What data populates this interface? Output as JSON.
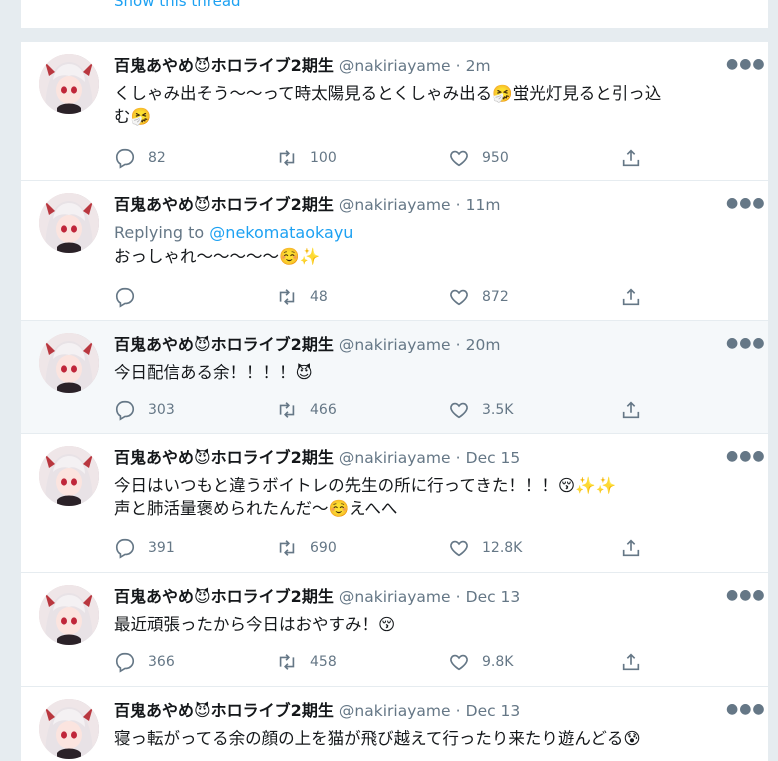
{
  "thread": {
    "show_thread_label": "Show this thread"
  },
  "tweets": [
    {
      "name": "百鬼あやめ😈ホロライブ2期生",
      "handle": "@nakiriayame",
      "dot": "·",
      "time": "2m",
      "reply_prefix": "",
      "reply_to": "",
      "lines": [
        "くしゃみ出そう〜〜って時太陽見るとくしゃみ出る🤧蛍光灯見ると引っ込",
        "む🤧"
      ],
      "replies": "82",
      "retweets": "100",
      "likes": "950"
    },
    {
      "name": "百鬼あやめ😈ホロライブ2期生",
      "handle": "@nakiriayame",
      "dot": "·",
      "time": "11m",
      "reply_prefix": "Replying to ",
      "reply_to": "@nekomataokayu",
      "lines": [
        "おっしゃれ〜〜〜〜〜☺️✨"
      ],
      "replies": "",
      "retweets": "48",
      "likes": "872"
    },
    {
      "name": "百鬼あやめ😈ホロライブ2期生",
      "handle": "@nakiriayame",
      "dot": "·",
      "time": "20m",
      "reply_prefix": "",
      "reply_to": "",
      "lines": [
        "今日配信ある余！！！！😈"
      ],
      "replies": "303",
      "retweets": "466",
      "likes": "3.5K"
    },
    {
      "name": "百鬼あやめ😈ホロライブ2期生",
      "handle": "@nakiriayame",
      "dot": "·",
      "time": "Dec 15",
      "reply_prefix": "",
      "reply_to": "",
      "lines": [
        "今日はいつもと違うボイトレの先生の所に行ってきた！！！😚✨✨",
        "声と肺活量褒められたんだ〜☺️えへへ"
      ],
      "replies": "391",
      "retweets": "690",
      "likes": "12.8K"
    },
    {
      "name": "百鬼あやめ😈ホロライブ2期生",
      "handle": "@nakiriayame",
      "dot": "·",
      "time": "Dec 13",
      "reply_prefix": "",
      "reply_to": "",
      "lines": [
        "最近頑張ったから今日はおやすみ！😚"
      ],
      "replies": "366",
      "retweets": "458",
      "likes": "9.8K"
    },
    {
      "name": "百鬼あやめ😈ホロライブ2期生",
      "handle": "@nakiriayame",
      "dot": "·",
      "time": "Dec 13",
      "reply_prefix": "",
      "reply_to": "",
      "lines": [
        "寝っ転がってる余の顔の上を猫が飛び越えて行ったり来たり遊んどる😰"
      ],
      "replies": "",
      "retweets": "",
      "likes": ""
    }
  ],
  "icons": [
    "reply-icon",
    "retweet-icon",
    "like-icon",
    "share-icon",
    "more-icon"
  ],
  "colors": {
    "accent": "#1da1f2",
    "muted": "#657786",
    "border": "#e6ecf0",
    "highlight_bg": "#f5f8fa"
  }
}
